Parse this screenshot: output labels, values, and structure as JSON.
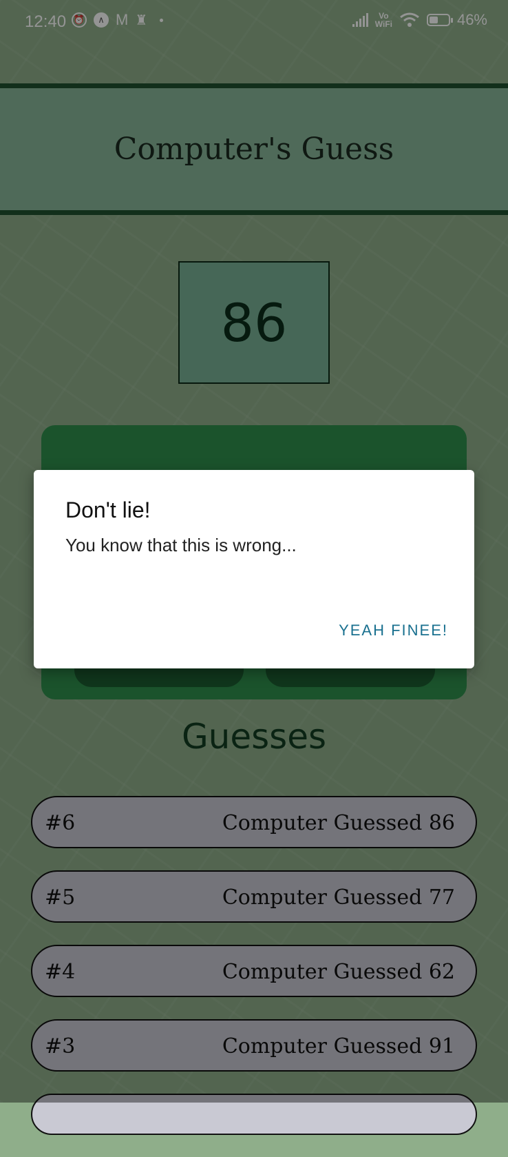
{
  "status_bar": {
    "time": "12:40",
    "vowifi_top": "Vo",
    "vowifi_bottom": "WiFi",
    "battery": "46%",
    "battery_level": 0.46
  },
  "header": {
    "title": "Computer's Guess"
  },
  "current_guess": "86",
  "guesses_title": "Guesses",
  "guesses": [
    {
      "num": "#6",
      "text": "Computer Guessed 86"
    },
    {
      "num": "#5",
      "text": "Computer Guessed 77"
    },
    {
      "num": "#4",
      "text": "Computer Guessed 62"
    },
    {
      "num": "#3",
      "text": "Computer Guessed 91"
    }
  ],
  "dialog": {
    "title": "Don't lie!",
    "message": "You know that this is wrong...",
    "action": "YEAH FINEE!"
  },
  "colors": {
    "accent": "#2f8f4d",
    "header_border": "#1f5130",
    "dialog_action": "#19708f"
  }
}
